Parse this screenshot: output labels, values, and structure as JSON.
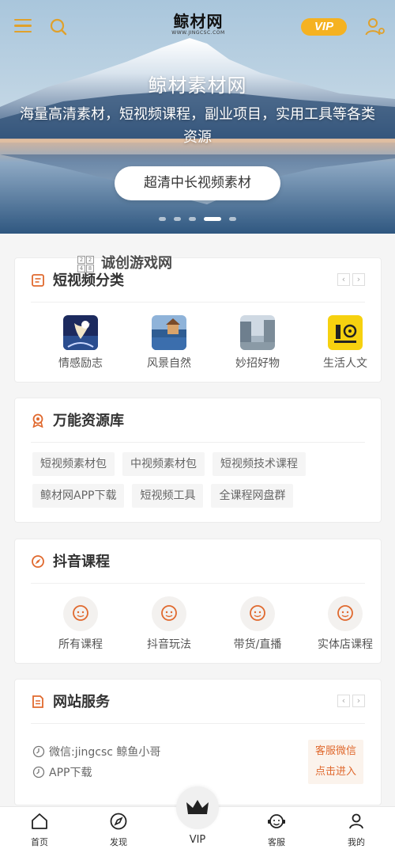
{
  "header": {
    "logo_main": "鲸材网",
    "logo_sub": "WWW.JINGCSC.COM",
    "vip_label": "VIP"
  },
  "hero": {
    "title": "鲸材素材网",
    "description": "海量高清素材，短视频课程，副业项目，实用工具等各类资源",
    "button_label": "超清中长视频素材",
    "slides_count": 5,
    "active_slide": 4
  },
  "watermark": {
    "text": "诚创游戏网",
    "grid": [
      "2",
      "2",
      "4",
      "8"
    ]
  },
  "short_video_section": {
    "title": "短视频分类",
    "pager_prev": "‹",
    "pager_next": "›",
    "categories": [
      {
        "label": "情感励志",
        "icon": "moon-night-thumb"
      },
      {
        "label": "风景自然",
        "icon": "lake-scenery-thumb"
      },
      {
        "label": "妙招好物",
        "icon": "street-thumb"
      },
      {
        "label": "生活人文",
        "icon": "cart-logo-thumb"
      }
    ]
  },
  "resource_section": {
    "title": "万能资源库",
    "tag_rows": [
      [
        "短视频素材包",
        "中视频素材包",
        "短视频技术课程"
      ],
      [
        "鲸材网APP下载",
        "短视频工具",
        "全课程网盘群"
      ]
    ]
  },
  "douyin_section": {
    "title": "抖音课程",
    "courses": [
      {
        "label": "所有课程"
      },
      {
        "label": "抖音玩法"
      },
      {
        "label": "带货/直播"
      },
      {
        "label": "实体店课程"
      }
    ]
  },
  "service_section": {
    "title": "网站服务",
    "pager_prev": "‹",
    "pager_next": "›",
    "lines": [
      "微信:jingcsc 鲸鱼小哥",
      "APP下载"
    ],
    "button_line1": "客服微信",
    "button_line2": "点击进入"
  },
  "bottom_nav": {
    "items": [
      {
        "label": "首页",
        "icon": "home-icon"
      },
      {
        "label": "发现",
        "icon": "compass-icon"
      },
      {
        "label": "VIP",
        "icon": "crown-icon"
      },
      {
        "label": "客服",
        "icon": "support-icon"
      },
      {
        "label": "我的",
        "icon": "profile-icon"
      }
    ]
  },
  "colors": {
    "accent": "#e0692e",
    "gold": "#f5b221",
    "menu": "#e0a12b"
  }
}
